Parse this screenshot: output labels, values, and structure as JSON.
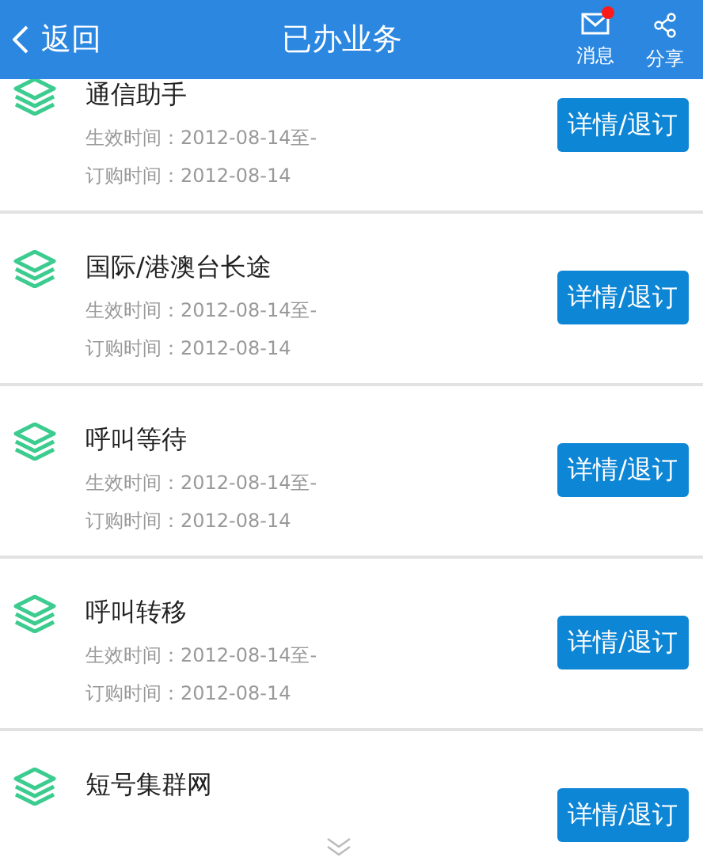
{
  "header": {
    "back": "返回",
    "title": "已办业务",
    "actions": [
      {
        "label": "消息",
        "kind": "mail",
        "badge": true
      },
      {
        "label": "分享",
        "kind": "share",
        "badge": false
      }
    ]
  },
  "services": [
    {
      "name": "通信助手",
      "details": [
        "生效时间：2012-08-14至-",
        "订购时间：2012-08-14"
      ],
      "button": "详情/退订"
    },
    {
      "name": "国际/港澳台长途",
      "details": [
        "生效时间：2012-08-14至-",
        "订购时间：2012-08-14"
      ],
      "button": "详情/退订"
    },
    {
      "name": "呼叫等待",
      "details": [
        "生效时间：2012-08-14至-",
        "订购时间：2012-08-14"
      ],
      "button": "详情/退订"
    },
    {
      "name": "呼叫转移",
      "details": [
        "生效时间：2012-08-14至-",
        "订购时间：2012-08-14"
      ],
      "button": "详情/退订"
    },
    {
      "name": "短号集群网",
      "button": "详情/退订"
    }
  ]
}
